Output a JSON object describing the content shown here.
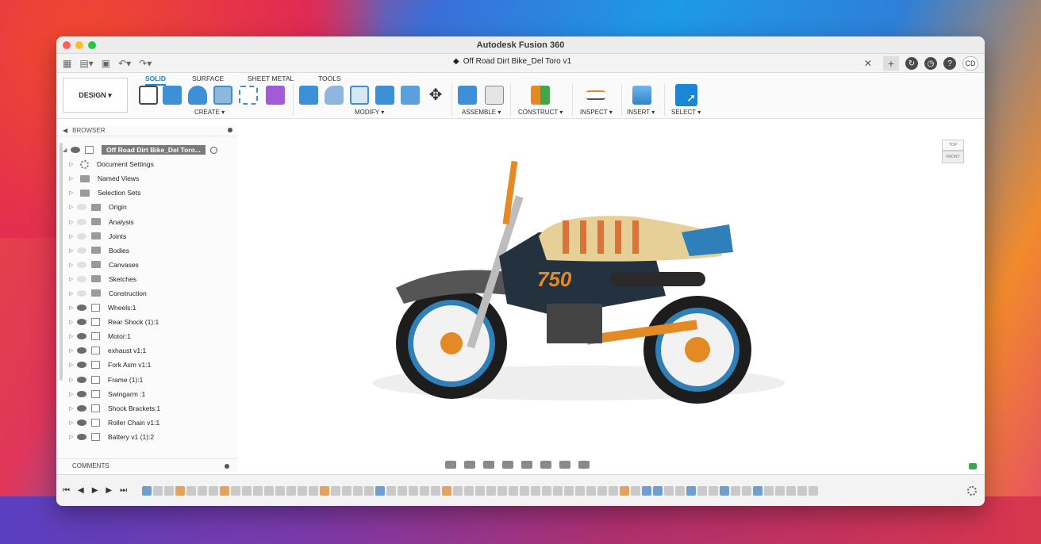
{
  "window": {
    "app_title": "Autodesk Fusion 360",
    "document_title": "Off Road Dirt Bike_Del Toro v1",
    "user_initials": "CD"
  },
  "ribbon": {
    "workspace": "DESIGN ▾",
    "tabs": [
      "SOLID",
      "SURFACE",
      "SHEET METAL",
      "TOOLS"
    ],
    "active_tab": "SOLID",
    "groups": [
      "CREATE ▾",
      "MODIFY ▾",
      "ASSEMBLE ▾",
      "CONSTRUCT ▾",
      "INSPECT ▾",
      "INSERT ▾",
      "SELECT ▾"
    ]
  },
  "browser": {
    "title": "BROWSER",
    "root": "Off Road Dirt Bike_Del Toro...",
    "items": [
      {
        "label": "Document Settings",
        "type": "gear"
      },
      {
        "label": "Named Views",
        "type": "folder"
      },
      {
        "label": "Selection Sets",
        "type": "folder"
      },
      {
        "label": "Origin",
        "type": "folder"
      },
      {
        "label": "Analysis",
        "type": "folder"
      },
      {
        "label": "Joints",
        "type": "folder"
      },
      {
        "label": "Bodies",
        "type": "folder"
      },
      {
        "label": "Canvases",
        "type": "folder"
      },
      {
        "label": "Sketches",
        "type": "folder"
      },
      {
        "label": "Construction",
        "type": "folder"
      },
      {
        "label": "Wheels:1",
        "type": "component"
      },
      {
        "label": "Rear Shock (1):1",
        "type": "component"
      },
      {
        "label": "Motor:1",
        "type": "component"
      },
      {
        "label": "exhaust v1:1",
        "type": "component"
      },
      {
        "label": "Fork Asm v1:1",
        "type": "component"
      },
      {
        "label": "Frame (1):1",
        "type": "component"
      },
      {
        "label": "Swingarm :1",
        "type": "component"
      },
      {
        "label": "Shock Brackets:1",
        "type": "component"
      },
      {
        "label": "Roller Chain v1:1",
        "type": "component"
      },
      {
        "label": "Battery v1 (1):2",
        "type": "component"
      }
    ]
  },
  "viewcube": {
    "top": "TOP",
    "front": "FRONT"
  },
  "comments": {
    "title": "COMMENTS"
  },
  "model": {
    "number_plate": "750"
  },
  "colors": {
    "accent": "#1a86d6",
    "bike_blue": "#2f7fb8",
    "bike_orange": "#e48a24",
    "seat": "#e7cf98"
  }
}
